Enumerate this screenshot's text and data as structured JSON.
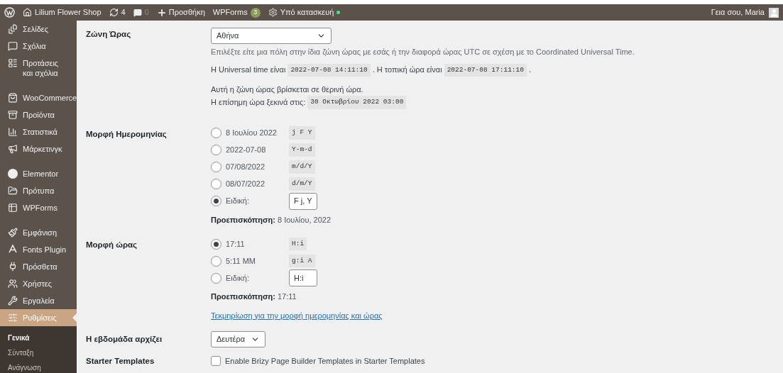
{
  "admin_bar": {
    "site": "Lilium Flower Shop",
    "updates": "4",
    "comments": "0",
    "new": "Προσθήκη",
    "wpforms": "WPForms",
    "wpforms_badge": "3",
    "maintenance": "Υπό κατασκευή",
    "greeting": "Γεια σου, Maria"
  },
  "sidebar": {
    "groups": [
      [
        {
          "label": "Σελίδες",
          "selected": false
        },
        {
          "label": "Σχόλια",
          "selected": false
        },
        {
          "label": "Προτάσεις και σχόλια",
          "selected": false
        }
      ],
      [
        {
          "label": "WooCommerce",
          "selected": false
        },
        {
          "label": "Προϊόντα",
          "selected": false
        },
        {
          "label": "Στατιστικά",
          "selected": false
        },
        {
          "label": "Μάρκετινγκ",
          "selected": false
        }
      ],
      [
        {
          "label": "Elementor",
          "selected": false
        },
        {
          "label": "Πρότυπα",
          "selected": false
        },
        {
          "label": "WPForms",
          "selected": false
        }
      ],
      [
        {
          "label": "Εμφάνιση",
          "selected": false
        },
        {
          "label": "Fonts Plugin",
          "selected": false
        },
        {
          "label": "Πρόσθετα",
          "selected": false
        },
        {
          "label": "Χρήστες",
          "selected": false
        },
        {
          "label": "Εργαλεία",
          "selected": false
        },
        {
          "label": "Ρυθμίσεις",
          "selected": true
        }
      ]
    ],
    "submenu": [
      {
        "label": "Γενικά",
        "selected": true
      },
      {
        "label": "Σύνταξη",
        "selected": false
      },
      {
        "label": "Ανάγνωση",
        "selected": false
      }
    ]
  },
  "timezone": {
    "label": "Ζώνη Ώρας",
    "value": "Αθήνα",
    "description": "Επιλέξτε είτε μια πόλη στην ίδια ζώνη ώρας με εσάς ή την διαφορά ώρας UTC σε σχέση με το Coordinated Universal Time.",
    "universal_label": "Η Universal time είναι",
    "universal_value": "2022-07-08 14:11:10",
    "local_label": ". Η τοπική ώρα είναι",
    "local_value": "2022-07-08 17:11:10",
    "local_end": ".",
    "dst_note": "Αυτή η ζώνη ώρας βρίσκεται σε θερινή ώρα.",
    "dst_label": "Η επίσημη ώρα ξεκινά στις:",
    "dst_value": "30 Οκτωβρίου 2022 03:00"
  },
  "date_format": {
    "label": "Μορφή Ημερομηνίας",
    "options": [
      {
        "kind": "preset",
        "label": "8 Ιουλίου 2022",
        "code": "j F Y",
        "selected": false
      },
      {
        "kind": "preset",
        "label": "2022-07-08",
        "code": "Y-m-d",
        "selected": false
      },
      {
        "kind": "preset",
        "label": "07/08/2022",
        "code": "m/d/Y",
        "selected": false
      },
      {
        "kind": "preset",
        "label": "08/07/2022",
        "code": "d/m/Y",
        "selected": false
      },
      {
        "kind": "custom",
        "label": "Ειδική:",
        "value": "F j, Y",
        "selected": true
      }
    ],
    "preview_label": "Προεπισκόπηση:",
    "preview": "8 Ιουλίου, 2022"
  },
  "time_format": {
    "label": "Μορφή ώρας",
    "options": [
      {
        "kind": "preset",
        "label": "17:11",
        "code": "H:i",
        "selected": true
      },
      {
        "kind": "preset",
        "label": "5:11 ΜΜ",
        "code": "g:i A",
        "selected": false
      },
      {
        "kind": "custom",
        "label": "Ειδική:",
        "value": "H:i",
        "selected": false
      }
    ],
    "preview_label": "Προεπισκόπηση:",
    "preview": "17:11",
    "doc_link": "Τεκμηρίωση για την μορφή ημερομηνίας και ώρας"
  },
  "week_start": {
    "label": "Η εβδομάδα αρχίζει",
    "value": "Δευτέρα"
  },
  "starter_templates": {
    "label": "Starter Templates",
    "checkbox_label": "Enable Brizy Page Builder Templates in Starter Templates",
    "checked": false
  }
}
